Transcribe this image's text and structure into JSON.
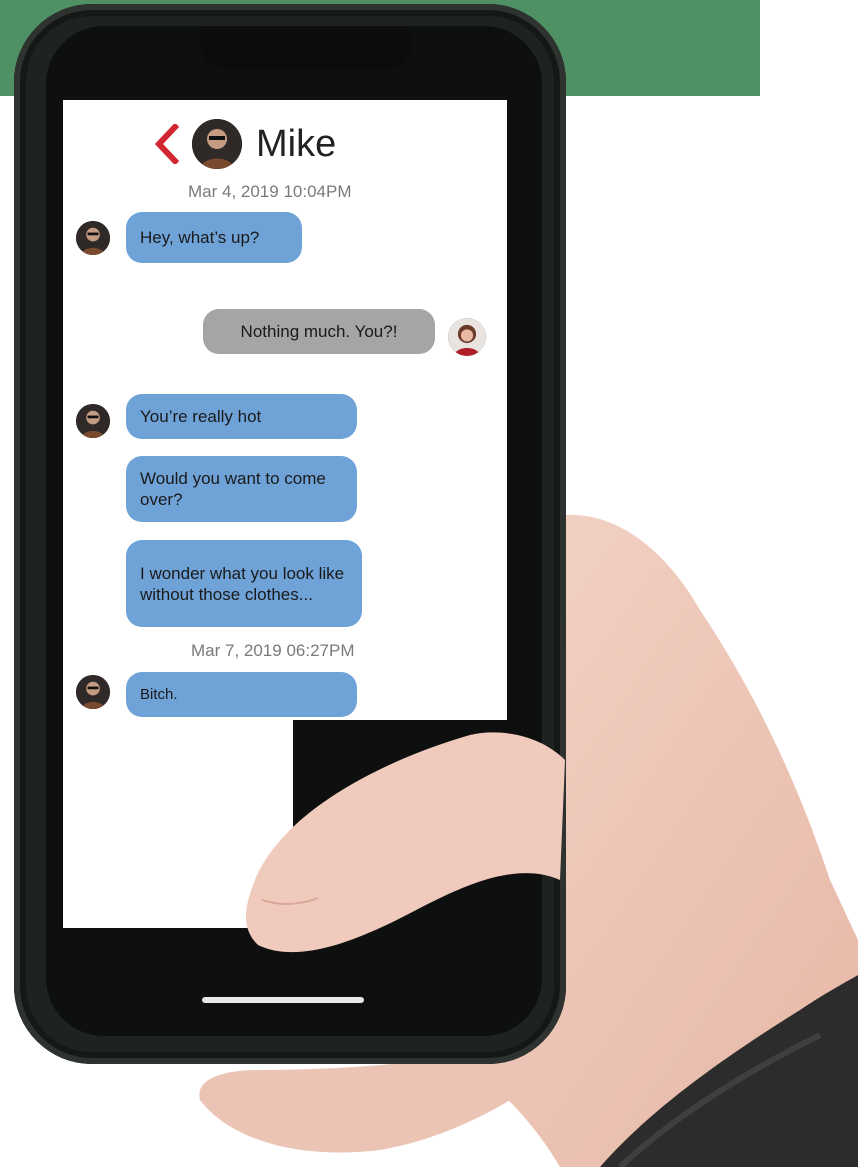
{
  "contact": {
    "name": "Mike"
  },
  "timestamps": [
    "Mar 4, 2019 10:04PM",
    "Mar 7, 2019 06:27PM"
  ],
  "messages": [
    {
      "from": "Mike",
      "text": "Hey, what’s up?"
    },
    {
      "from": "me",
      "text": "Nothing much. You?!"
    },
    {
      "from": "Mike",
      "text": "You’re really hot"
    },
    {
      "from": "Mike",
      "text": "Would you want to come over?"
    },
    {
      "from": "Mike",
      "text": "I wonder what you look like without those clothes..."
    },
    {
      "from": "Mike",
      "text": "Bitch."
    }
  ],
  "icons": {
    "back": "chevron-left-icon",
    "contact_avatar": "avatar-icon"
  },
  "colors": {
    "background_top": "#4f9165",
    "incoming_bubble": "#6fa3d8",
    "outgoing_bubble": "#a4a5a7",
    "back_arrow": "#d22630",
    "timestamp": "#7a7a7a"
  }
}
